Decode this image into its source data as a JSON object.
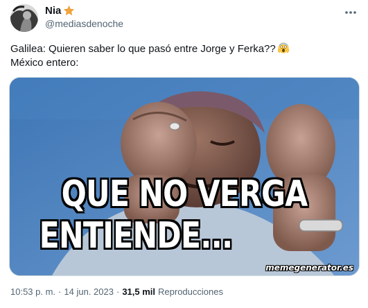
{
  "author": {
    "display_name": "Nia",
    "handle": "@mediasdenoche",
    "badge_icon": "star-icon",
    "badge_color": "#f4a63b"
  },
  "tweet": {
    "line_1": "Galilea: Quieren saber lo que pasó entre Jorge y Ferka??",
    "line_1_emoji": "face-screaming-in-fear-emoji",
    "line_2": "México entero:"
  },
  "media": {
    "caption_line_1": "QUE NO VERGA",
    "caption_line_2": "ENTIENDE...",
    "watermark": "memegenerator.es"
  },
  "meta": {
    "time": "10:53 p. m.",
    "separator_1": "·",
    "date": "14 jun. 2023",
    "separator_2": "·",
    "views_count": "31,5 mil",
    "views_label": "Reproducciones"
  },
  "colors": {
    "text_primary": "#0f1419",
    "text_secondary": "#536471",
    "border": "#cfd9de"
  }
}
